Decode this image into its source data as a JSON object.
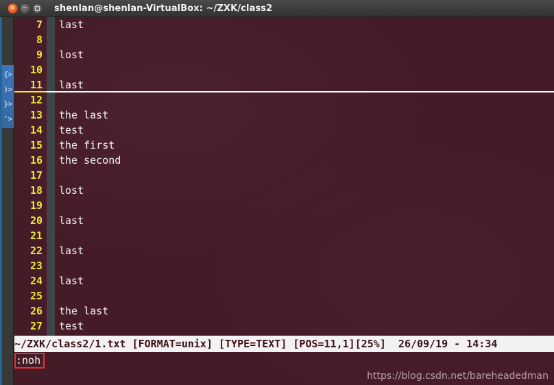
{
  "window": {
    "title": "shenlan@shenlan-VirtualBox: ~/ZXK/class2",
    "close_label": "×",
    "minimize_label": "−",
    "maximize_label": ""
  },
  "launcher": {
    "icon_name": "terminal-launcher-icon",
    "glyph_lines": [
      "{>",
      ")>",
      "}>",
      "'>"
    ]
  },
  "editor": {
    "cursor_line_number": "11",
    "lines": [
      {
        "num": "7",
        "text": "last"
      },
      {
        "num": "8",
        "text": ""
      },
      {
        "num": "9",
        "text": "lost"
      },
      {
        "num": "10",
        "text": ""
      },
      {
        "num": "11",
        "text": "last"
      },
      {
        "num": "12",
        "text": ""
      },
      {
        "num": "13",
        "text": "the last"
      },
      {
        "num": "14",
        "text": "test"
      },
      {
        "num": "15",
        "text": "the first"
      },
      {
        "num": "16",
        "text": "the second"
      },
      {
        "num": "17",
        "text": ""
      },
      {
        "num": "18",
        "text": "lost"
      },
      {
        "num": "19",
        "text": ""
      },
      {
        "num": "20",
        "text": "last"
      },
      {
        "num": "21",
        "text": ""
      },
      {
        "num": "22",
        "text": "last"
      },
      {
        "num": "23",
        "text": ""
      },
      {
        "num": "24",
        "text": "last"
      },
      {
        "num": "25",
        "text": ""
      },
      {
        "num": "26",
        "text": "the last"
      },
      {
        "num": "27",
        "text": "test"
      }
    ]
  },
  "statusline": {
    "text": "~/ZXK/class2/1.txt [FORMAT=unix] [TYPE=TEXT] [POS=11,1][25%]  26/09/19 - 14:34",
    "file_path": "~/ZXK/class2/1.txt",
    "format": "[FORMAT=unix]",
    "type": "[TYPE=TEXT]",
    "position": "[POS=11,1]",
    "percent": "[25%]",
    "date": "26/09/19",
    "time": "14:34"
  },
  "commandline": {
    "text": ":noh",
    "highlight_color": "#e63030"
  },
  "watermark": {
    "text": "https://blog.csdn.net/bareheadedman"
  },
  "colors": {
    "terminal_bg": "#461b28",
    "line_number": "#eaea30",
    "text": "#f5f5f5",
    "fold_column": "#3d4549",
    "status_bg": "#f2f2f2",
    "status_fg": "#3c1018",
    "titlebar_bg": "#3c3c3c",
    "launcher_bg": "#393939",
    "launcher_icon": "#3a6fae"
  }
}
